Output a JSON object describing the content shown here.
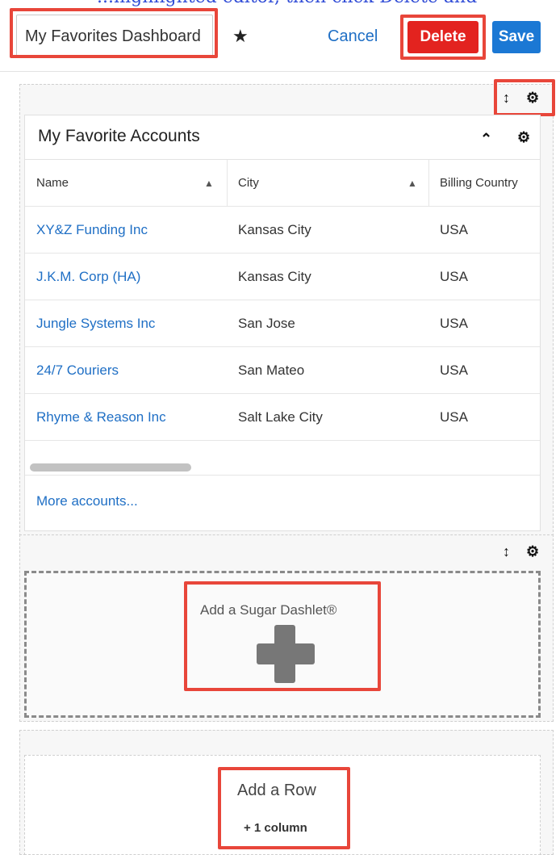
{
  "top_strip_text": "...highlighted editor, then click Delete and Save...",
  "header": {
    "name_value": "My Favorites Dashboard",
    "favorite_icon": "star-icon",
    "cancel_label": "Cancel",
    "delete_label": "Delete",
    "save_label": "Save"
  },
  "row1_controls": {
    "resize_icon": "resize-vertical-icon",
    "gear_icon": "gear-icon"
  },
  "dashlet": {
    "title": "My Favorite Accounts",
    "collapse_icon": "chevron-up-icon",
    "gear_icon": "gear-icon",
    "columns": [
      {
        "label": "Name",
        "sortable": true
      },
      {
        "label": "City",
        "sortable": true
      },
      {
        "label": "Billing Country",
        "sortable": false
      }
    ],
    "rows": [
      {
        "name": "XY&Z Funding Inc",
        "city": "Kansas City",
        "country": "USA"
      },
      {
        "name": "J.K.M. Corp (HA)",
        "city": "Kansas City",
        "country": "USA"
      },
      {
        "name": "Jungle Systems Inc",
        "city": "San Jose",
        "country": "USA"
      },
      {
        "name": "24/7 Couriers",
        "city": "San Mateo",
        "country": "USA"
      },
      {
        "name": "Rhyme & Reason Inc",
        "city": "Salt Lake City",
        "country": "USA"
      }
    ],
    "more_link": "More accounts..."
  },
  "row2_controls": {
    "resize_icon": "resize-vertical-icon",
    "gear_icon": "gear-icon"
  },
  "add_dashlet": {
    "label": "Add a Sugar Dashlet®",
    "icon": "plus-icon"
  },
  "add_row": {
    "label": "Add a Row",
    "column_label": "+ 1 column"
  },
  "colors": {
    "highlight": "#e8463a",
    "delete": "#e3231f",
    "save": "#1b78d4",
    "link": "#1f6fc5"
  }
}
